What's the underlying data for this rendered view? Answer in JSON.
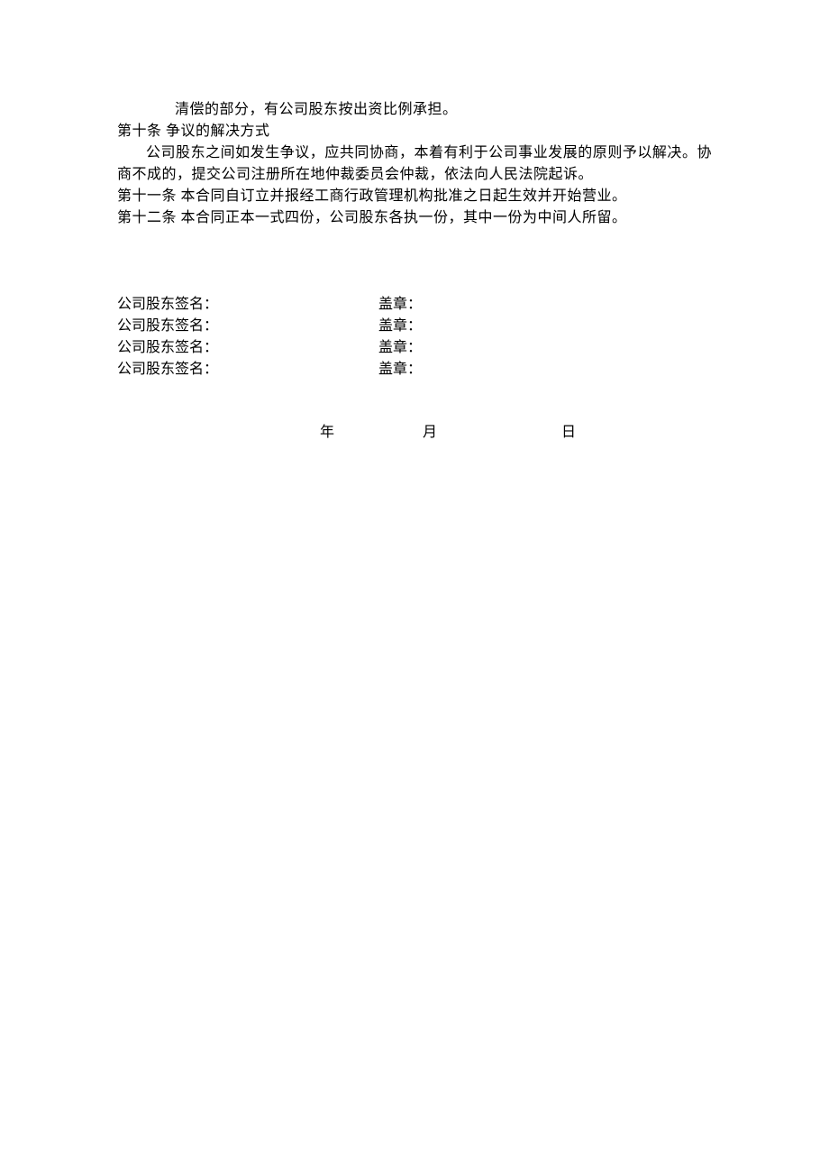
{
  "body": {
    "line1": "清偿的部分，有公司股东按出资比例承担。",
    "article10_heading": "第十条  争议的解决方式",
    "article10_p1_a": "公司股东之间如发生争议，应共同协商，本着有利于公司事业发展的原则予以解决。协",
    "article10_p1_b": "商不成的，提交公司注册所在地仲裁委员会仲裁，依法向人民法院起诉。",
    "article11": "第十一条  本合同自订立并报经工商行政管理机构批准之日起生效并开始营业。",
    "article12": "第十二条  本合同正本一式四份，公司股东各执一份，其中一份为中间人所留。"
  },
  "signatures": [
    {
      "left": "公司股东签名：",
      "right": "盖章："
    },
    {
      "left": "公司股东签名：",
      "right": "盖章："
    },
    {
      "left": "公司股东签名：",
      "right": "盖章："
    },
    {
      "left": "公司股东签名：",
      "right": "盖章："
    }
  ],
  "date": {
    "year": "年",
    "month": "月",
    "day": "日"
  }
}
